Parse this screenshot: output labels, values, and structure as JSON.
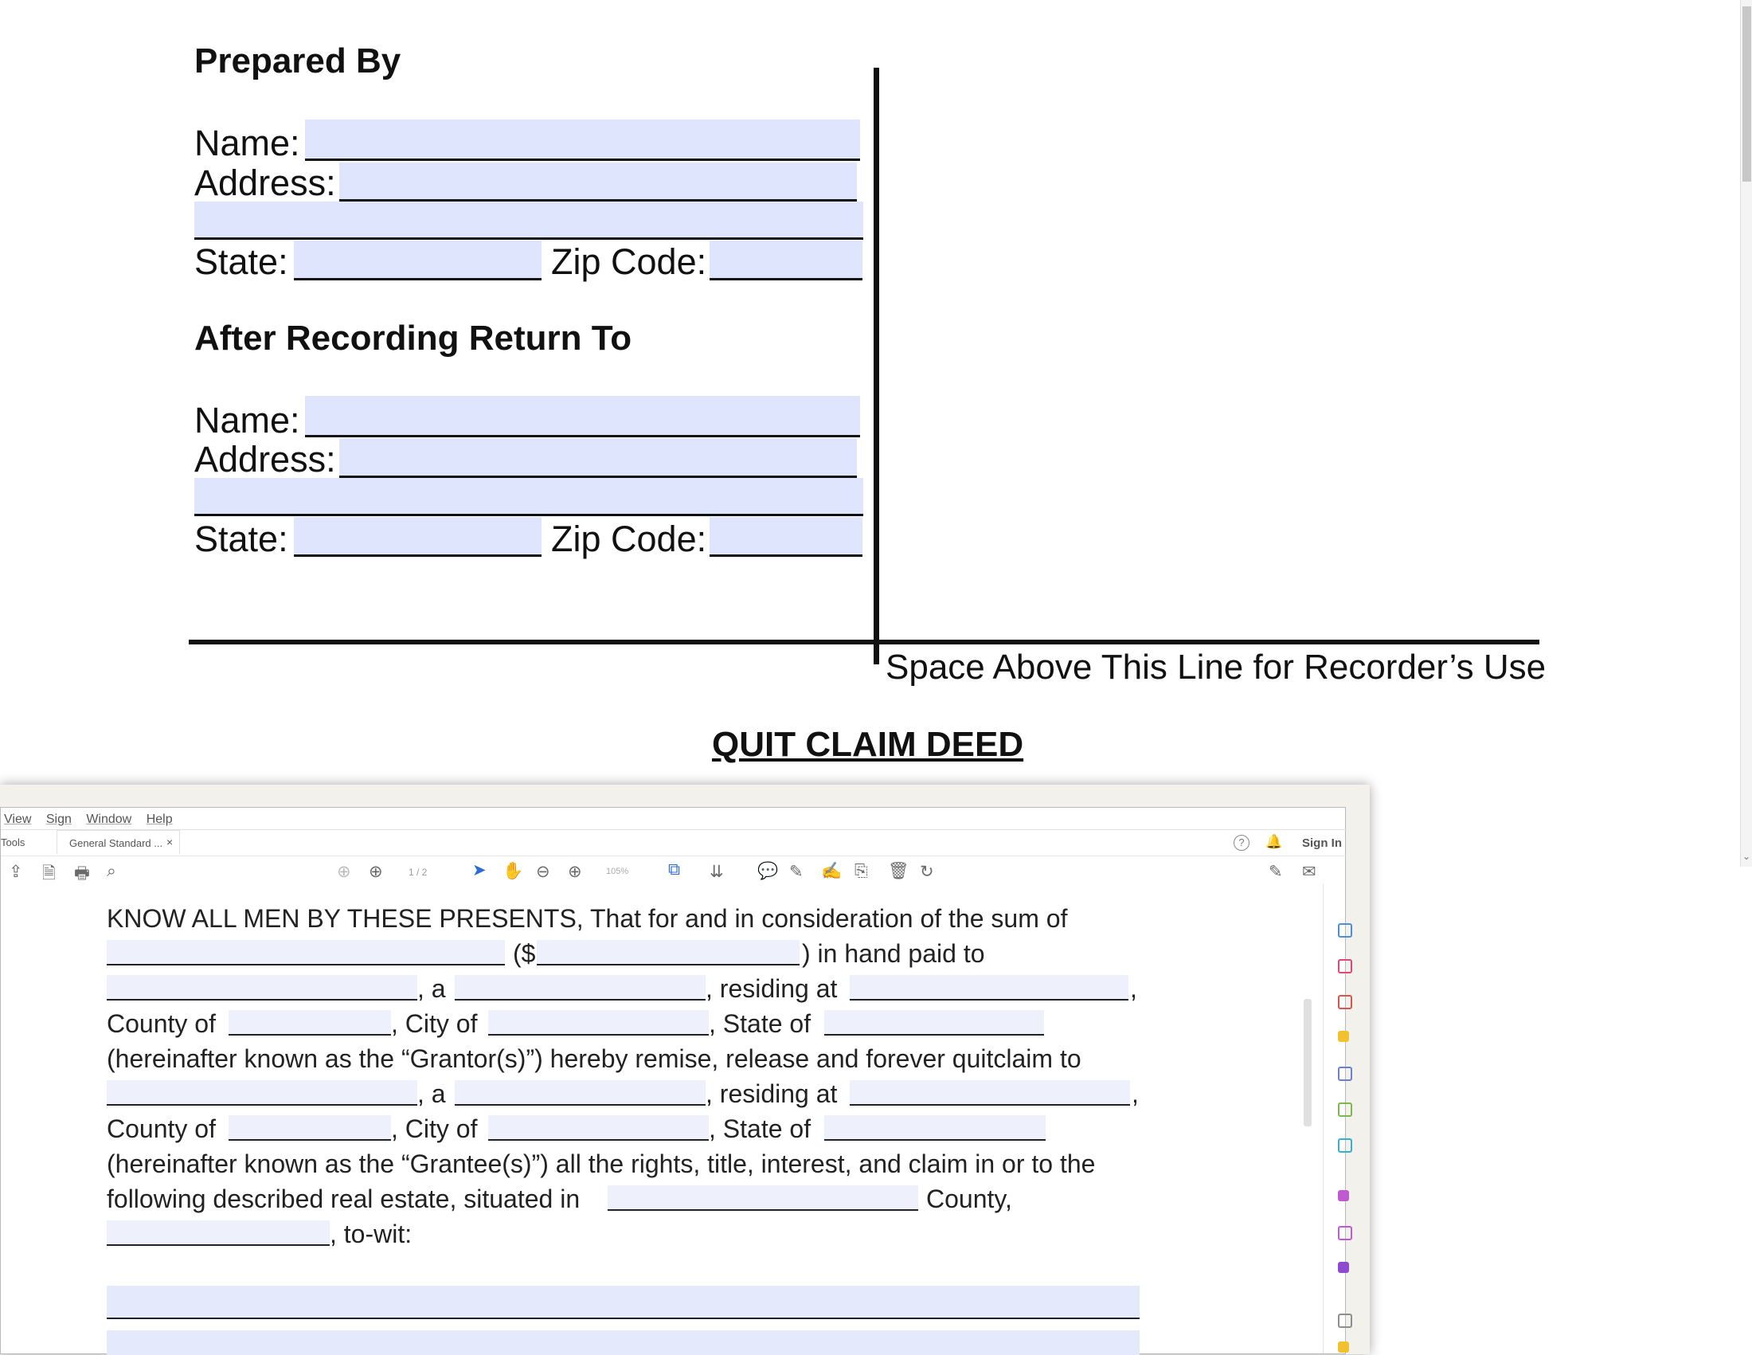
{
  "prepared_by": {
    "heading": "Prepared By",
    "name_label": "Name:",
    "address_label": "Address:",
    "state_label": "State:",
    "zip_label": "Zip Code:"
  },
  "return_to": {
    "heading": "After Recording Return To",
    "name_label": "Name:",
    "address_label": "Address:",
    "state_label": "State:",
    "zip_label": "Zip Code:"
  },
  "recorder_note": "Space Above This Line for Recorder’s Use",
  "doc_title": "QUIT CLAIM DEED",
  "viewer": {
    "menu": [
      "View",
      "Sign",
      "Window",
      "Help"
    ],
    "left_tab": "Tools",
    "doc_tab": "General Standard ...",
    "tab_close": "×",
    "sign_in": "Sign In",
    "page_indicator": "1 / 2",
    "zoom": "105%",
    "icons": {
      "help": "help-icon",
      "bell": "bell-icon",
      "upload": "upload-icon",
      "save": "save-icon",
      "print": "print-icon",
      "zoom_out": "zoom-icon",
      "prev": "prev-page-icon",
      "next": "next-page-icon",
      "select": "select-icon",
      "hand": "hand-icon",
      "minus": "zoom-out-icon",
      "plus": "zoom-in-icon"
    }
  },
  "body": {
    "line1": "KNOW ALL MEN BY THESE PRESENTS, That for and in consideration of the sum of",
    "dollar_open": "($",
    "in_hand": ") in hand paid to",
    "a": ", a",
    "residing": ", residing at",
    "comma": ",",
    "county_of": "County of",
    "city_of": ", City of",
    "state_of": ", State of",
    "grantor_line": "(hereinafter known as the “Grantor(s)”) hereby remise, release and forever quitclaim to",
    "grantee_line": "(hereinafter known as the “Grantee(s)”) all the rights, title, interest, and claim in or to the",
    "following": "following described real estate, situated in",
    "county": "County,",
    "to_wit": ", to-wit:"
  }
}
